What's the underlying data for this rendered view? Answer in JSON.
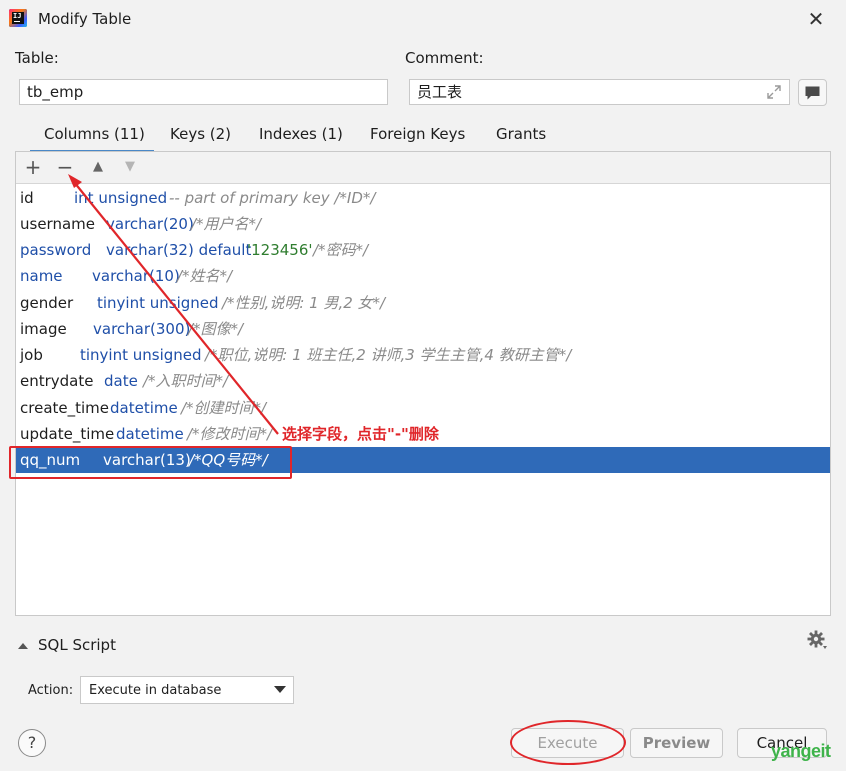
{
  "window": {
    "title": "Modify Table",
    "close_glyph": "✕"
  },
  "form": {
    "table_label": "Table:",
    "table_value": "tb_emp",
    "comment_label": "Comment:",
    "comment_value": "员工表"
  },
  "tabs": [
    {
      "label": "Columns (11)",
      "active": true
    },
    {
      "label": "Keys (2)"
    },
    {
      "label": "Indexes (1)"
    },
    {
      "label": "Foreign Keys"
    },
    {
      "label": "Grants"
    }
  ],
  "toolbar": {
    "add": "+",
    "remove": "−",
    "up": "▲",
    "down": "▼"
  },
  "columns": [
    {
      "name": "id",
      "type": "int unsigned",
      "comment": "-- part of primary key /*ID*/"
    },
    {
      "name": "username",
      "type": "varchar(20)",
      "comment": "/*用户名*/"
    },
    {
      "name": "password",
      "type": "varchar(32) default",
      "default": "'123456'",
      "comment": "/*密码*/"
    },
    {
      "name": "name",
      "type": "varchar(10)",
      "comment": "/*姓名*/"
    },
    {
      "name": "gender",
      "type": "tinyint unsigned",
      "comment": "/*性别,说明: 1 男,2 女*/"
    },
    {
      "name": "image",
      "type": "varchar(300)",
      "comment": "/*图像*/"
    },
    {
      "name": "job",
      "type": "tinyint unsigned",
      "comment": "/*职位,说明: 1 班主任,2 讲师,3 学生主管,4 教研主管*/"
    },
    {
      "name": "entrydate",
      "type": "date",
      "comment": "/*入职时间*/"
    },
    {
      "name": "create_time",
      "type": "datetime",
      "comment": "/*创建时间*/"
    },
    {
      "name": "update_time",
      "type": "datetime",
      "comment": "/*修改时间*/"
    },
    {
      "name": "qq_num",
      "type": "varchar(13)",
      "comment": "/*QQ号码*/",
      "selected": true
    }
  ],
  "annotation": {
    "text": "选择字段，点击\"-\"删除"
  },
  "sql_script": {
    "label": "SQL Script"
  },
  "action": {
    "label": "Action:",
    "value": "Execute in database"
  },
  "buttons": {
    "help": "?",
    "execute": "Execute",
    "preview": "Preview",
    "cancel": "Cancel"
  },
  "watermark": "yangeit",
  "colors": {
    "accent": "#4a88c7",
    "selection": "#2f6ab8",
    "annotation": "#e0262a",
    "type_blue": "#1f4fa8",
    "string_green": "#2f7d2f"
  }
}
